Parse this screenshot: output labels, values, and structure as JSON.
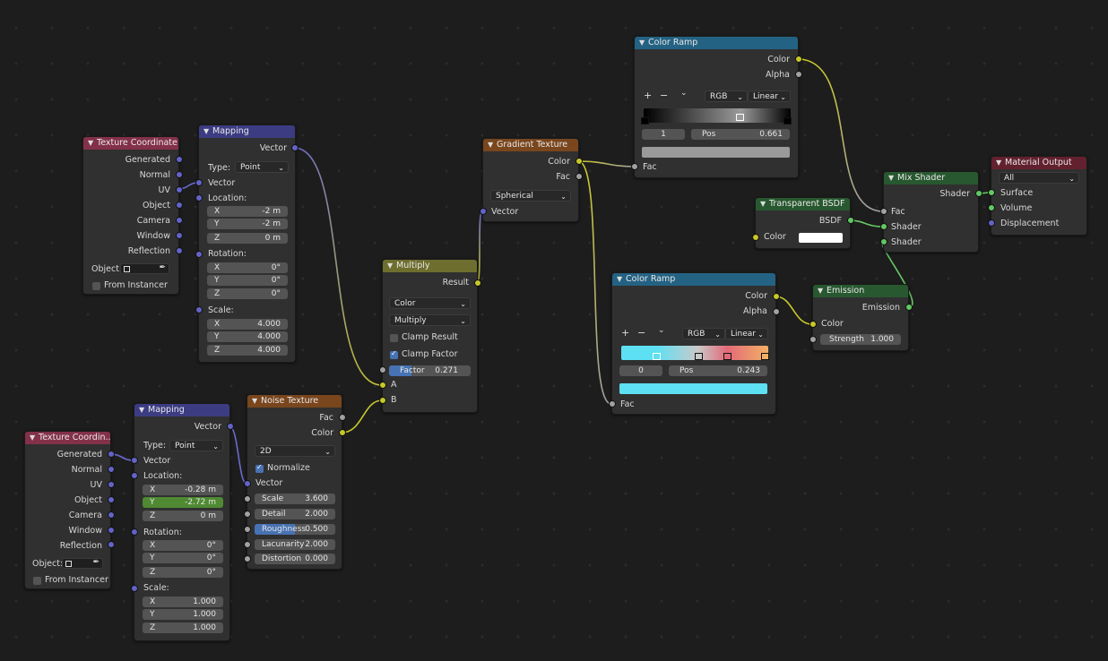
{
  "colors": {
    "background": "#1d1d1d",
    "node_body": "#303030",
    "input_header": "#83314a",
    "vector_header": "#3c3c83",
    "texture_header": "#79461d",
    "converter_header": "#246283",
    "shader_header": "#28582f",
    "output_header": "#63212f",
    "math_header": "#6e6e2e",
    "vector_socket": "#6363c7",
    "color_socket": "#c7c729",
    "float_socket": "#a1a1a1",
    "shader_socket": "#63c763"
  },
  "texcoord1": {
    "title": "Texture Coordinate",
    "outputs": [
      "Generated",
      "Normal",
      "UV",
      "Object",
      "Camera",
      "Window",
      "Reflection"
    ],
    "object_label": "Object:",
    "from_instancer": "From Instancer"
  },
  "mapping1": {
    "title": "Mapping",
    "out": "Vector",
    "type_label": "Type:",
    "type_value": "Point",
    "in_vector": "Vector",
    "location_label": "Location:",
    "loc": [
      {
        "axis": "X",
        "value": "-2 m"
      },
      {
        "axis": "Y",
        "value": "-2 m"
      },
      {
        "axis": "Z",
        "value": "0 m"
      }
    ],
    "rotation_label": "Rotation:",
    "rot": [
      {
        "axis": "X",
        "value": "0°"
      },
      {
        "axis": "Y",
        "value": "0°"
      },
      {
        "axis": "Z",
        "value": "0°"
      }
    ],
    "scale_label": "Scale:",
    "scale": [
      {
        "axis": "X",
        "value": "4.000"
      },
      {
        "axis": "Y",
        "value": "4.000"
      },
      {
        "axis": "Z",
        "value": "4.000"
      }
    ]
  },
  "texcoord2": {
    "title": "Texture Coordin...",
    "outputs": [
      "Generated",
      "Normal",
      "UV",
      "Object",
      "Camera",
      "Window",
      "Reflection"
    ],
    "object_label": "Object:",
    "from_instancer": "From Instancer"
  },
  "mapping2": {
    "title": "Mapping",
    "out": "Vector",
    "type_label": "Type:",
    "type_value": "Point",
    "in_vector": "Vector",
    "location_label": "Location:",
    "loc": [
      {
        "axis": "X",
        "value": "-0.28 m"
      },
      {
        "axis": "Y",
        "value": "-2.72 m"
      },
      {
        "axis": "Z",
        "value": "0 m"
      }
    ],
    "rotation_label": "Rotation:",
    "rot": [
      {
        "axis": "X",
        "value": "0°"
      },
      {
        "axis": "Y",
        "value": "0°"
      },
      {
        "axis": "Z",
        "value": "0°"
      }
    ],
    "scale_label": "Scale:",
    "scale": [
      {
        "axis": "X",
        "value": "1.000"
      },
      {
        "axis": "Y",
        "value": "1.000"
      },
      {
        "axis": "Z",
        "value": "1.000"
      }
    ]
  },
  "noise": {
    "title": "Noise Texture",
    "out_fac": "Fac",
    "out_color": "Color",
    "dimensions": "2D",
    "normalize": "Normalize",
    "in_vector": "Vector",
    "inputs": [
      {
        "label": "Scale",
        "value": "3.600"
      },
      {
        "label": "Detail",
        "value": "2.000"
      },
      {
        "label": "Roughness",
        "value": "0.500"
      },
      {
        "label": "Lacunarity",
        "value": "2.000"
      },
      {
        "label": "Distortion",
        "value": "0.000"
      }
    ],
    "roughness_fill": 0.5
  },
  "multiply": {
    "title": "Multiply",
    "out": "Result",
    "data_type": "Color",
    "blend": "Multiply",
    "clamp_result": "Clamp Result",
    "clamp_factor": "Clamp Factor",
    "factor_label": "Factor",
    "factor_value": "0.271",
    "factor_fill": 0.271,
    "in_a": "A",
    "in_b": "B"
  },
  "gradient": {
    "title": "Gradient Texture",
    "out_color": "Color",
    "out_fac": "Fac",
    "type": "Spherical",
    "in_vector": "Vector"
  },
  "ramp1": {
    "title": "Color Ramp",
    "out_color": "Color",
    "out_alpha": "Alpha",
    "plus": "+",
    "minus": "−",
    "mode": "RGB",
    "interp": "Linear",
    "index": "1",
    "pos_label": "Pos",
    "pos_value": "0.661",
    "in_fac": "Fac",
    "swatch": "#9a9a9a"
  },
  "ramp2": {
    "title": "Color Ramp",
    "out_color": "Color",
    "out_alpha": "Alpha",
    "plus": "+",
    "minus": "−",
    "mode": "RGB",
    "interp": "Linear",
    "index": "0",
    "pos_label": "Pos",
    "pos_value": "0.243",
    "in_fac": "Fac",
    "swatch": "#5ee0f3"
  },
  "transparent": {
    "title": "Transparent BSDF",
    "out": "BSDF",
    "in_color": "Color"
  },
  "emission": {
    "title": "Emission",
    "out": "Emission",
    "in_color": "Color",
    "strength_label": "Strength",
    "strength_value": "1.000"
  },
  "mix": {
    "title": "Mix Shader",
    "out": "Shader",
    "in_fac": "Fac",
    "in_shader1": "Shader",
    "in_shader2": "Shader"
  },
  "output": {
    "title": "Material Output",
    "target": "All",
    "in_surface": "Surface",
    "in_volume": "Volume",
    "in_disp": "Displacement"
  }
}
